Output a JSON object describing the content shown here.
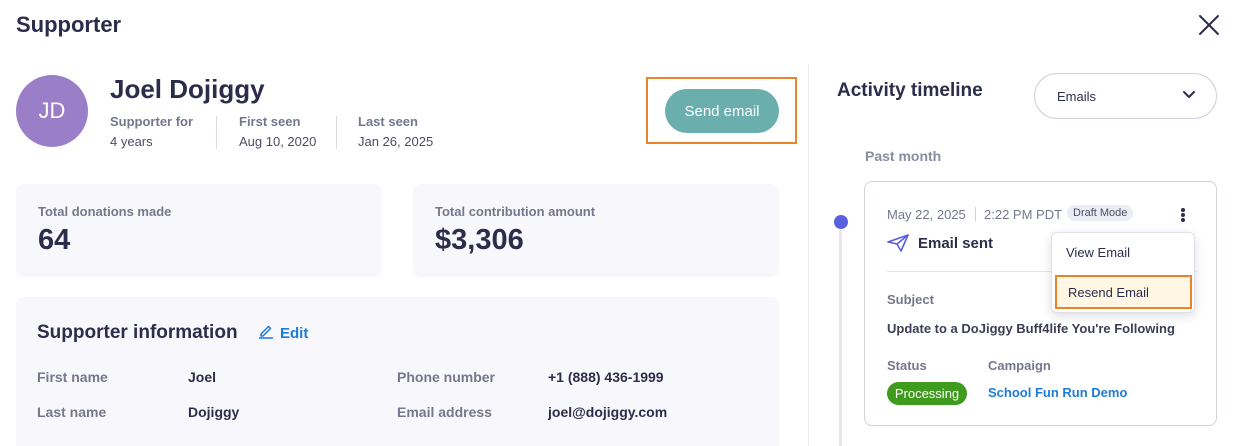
{
  "page": {
    "title": "Supporter"
  },
  "profile": {
    "initials": "JD",
    "name": "Joel Dojiggy",
    "supporter_for_label": "Supporter for",
    "supporter_for_value": "4 years",
    "first_seen_label": "First seen",
    "first_seen_value": "Aug 10, 2020",
    "last_seen_label": "Last seen",
    "last_seen_value": "Jan 26, 2025",
    "send_email_label": "Send email"
  },
  "stats": [
    {
      "label": "Total donations made",
      "value": "64"
    },
    {
      "label": "Total contribution amount",
      "value": "$3,306"
    }
  ],
  "info": {
    "title": "Supporter information",
    "edit_label": "Edit",
    "fields": {
      "first_name": {
        "label": "First name",
        "value": "Joel"
      },
      "last_name": {
        "label": "Last name",
        "value": "Dojiggy"
      },
      "phone": {
        "label": "Phone number",
        "value": "+1 (888) 436-1999"
      },
      "email": {
        "label": "Email address",
        "value": "joel@dojiggy.com"
      }
    }
  },
  "timeline": {
    "title": "Activity timeline",
    "filter_value": "Emails",
    "period": "Past month",
    "entry": {
      "date": "May 22, 2025",
      "time": "2:22 PM PDT",
      "badge": "Draft Mode",
      "type": "Email sent",
      "subject_label": "Subject",
      "subject": "Update to a DoJiggy Buff4life You're Following",
      "status_label": "Status",
      "status": "Processing",
      "campaign_label": "Campaign",
      "campaign": "School Fun Run Demo"
    },
    "menu": [
      "View Email",
      "Resend Email"
    ]
  },
  "colors": {
    "accent_teal": "#6aaeae",
    "highlight_orange": "#e8842a",
    "avatar": "#9b7ec8",
    "status_green": "#3e9b1e",
    "link_blue": "#1f7bd8",
    "timeline_dot": "#5a5fe0"
  },
  "icons": [
    "close-icon",
    "pencil-icon",
    "paper-plane-icon",
    "chevron-down-icon",
    "kebab-menu-icon"
  ]
}
